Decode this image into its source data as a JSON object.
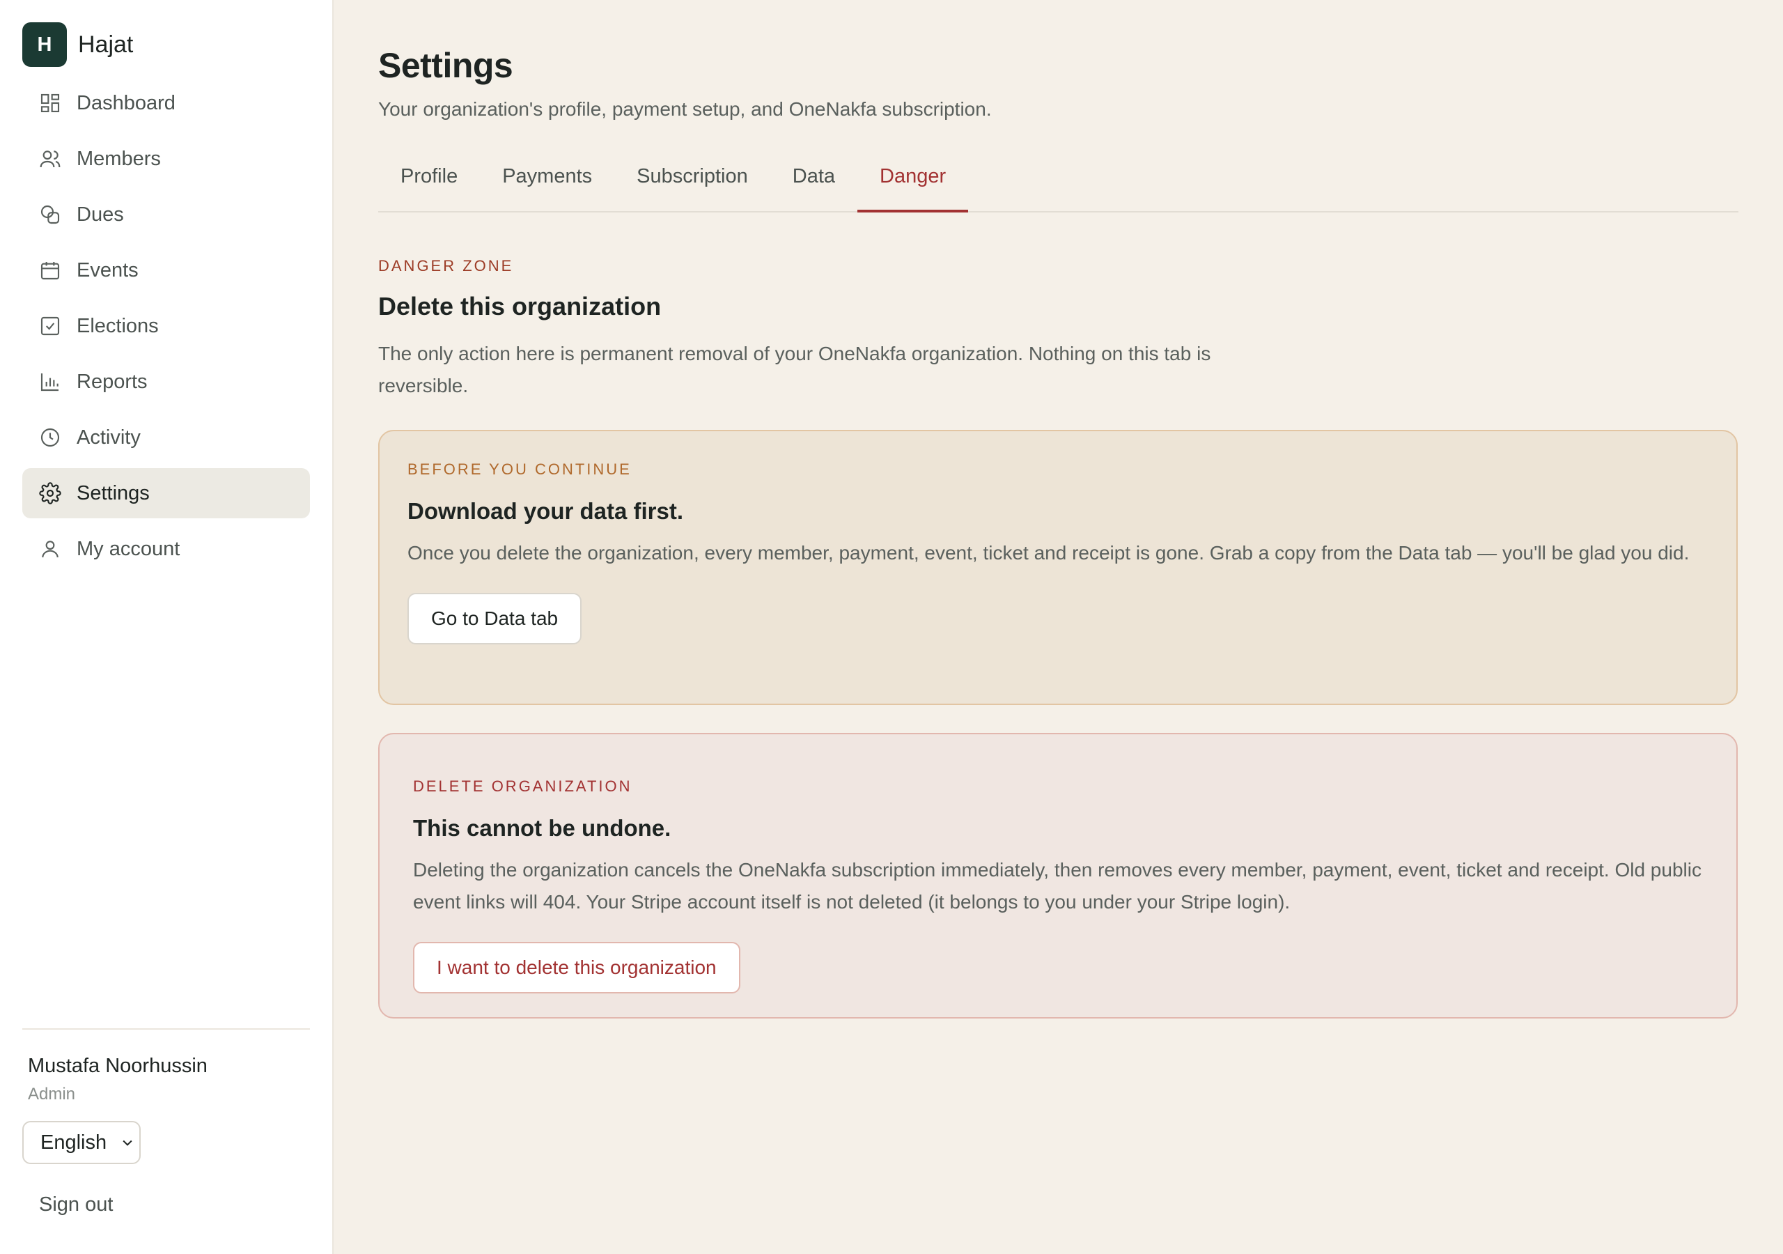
{
  "brand": {
    "initial": "H",
    "name": "Hajat"
  },
  "nav": [
    {
      "label": "Dashboard",
      "icon": "dashboard-icon",
      "active": false
    },
    {
      "label": "Members",
      "icon": "members-icon",
      "active": false
    },
    {
      "label": "Dues",
      "icon": "dues-icon",
      "active": false
    },
    {
      "label": "Events",
      "icon": "calendar-icon",
      "active": false
    },
    {
      "label": "Elections",
      "icon": "checkbox-icon",
      "active": false
    },
    {
      "label": "Reports",
      "icon": "bar-chart-icon",
      "active": false
    },
    {
      "label": "Activity",
      "icon": "clock-icon",
      "active": false
    },
    {
      "label": "Settings",
      "icon": "gear-icon",
      "active": true
    },
    {
      "label": "My account",
      "icon": "user-icon",
      "active": false
    }
  ],
  "user": {
    "name": "Mustafa Noorhussin",
    "role": "Admin"
  },
  "language": {
    "selected": "English"
  },
  "signout": "Sign out",
  "page": {
    "title": "Settings",
    "subtitle": "Your organization's profile, payment setup, and OneNakfa subscription."
  },
  "tabs": [
    {
      "label": "Profile",
      "active": false
    },
    {
      "label": "Payments",
      "active": false
    },
    {
      "label": "Subscription",
      "active": false
    },
    {
      "label": "Data",
      "active": false
    },
    {
      "label": "Danger",
      "active": true
    }
  ],
  "danger_zone": {
    "eyebrow": "DANGER ZONE",
    "heading": "Delete this organization",
    "description": "The only action here is permanent removal of your OneNakfa organization. Nothing on this tab is reversible."
  },
  "before_card": {
    "eyebrow": "BEFORE YOU CONTINUE",
    "title": "Download your data first.",
    "description": "Once you delete the organization, every member, payment, event, ticket and receipt is gone. Grab a copy from the Data tab — you'll be glad you did.",
    "button": "Go to Data tab"
  },
  "delete_card": {
    "eyebrow": "DELETE ORGANIZATION",
    "title": "This cannot be undone.",
    "description": "Deleting the organization cancels the OneNakfa subscription immediately, then removes every member, payment, event, ticket and receipt. Old public event links will 404. Your Stripe account itself is not deleted (it belongs to you under your Stripe login).",
    "button": "I want to delete this organization"
  },
  "colors": {
    "accent_danger": "#a23232",
    "brand": "#1b3a33",
    "background": "#f5f0e8"
  }
}
